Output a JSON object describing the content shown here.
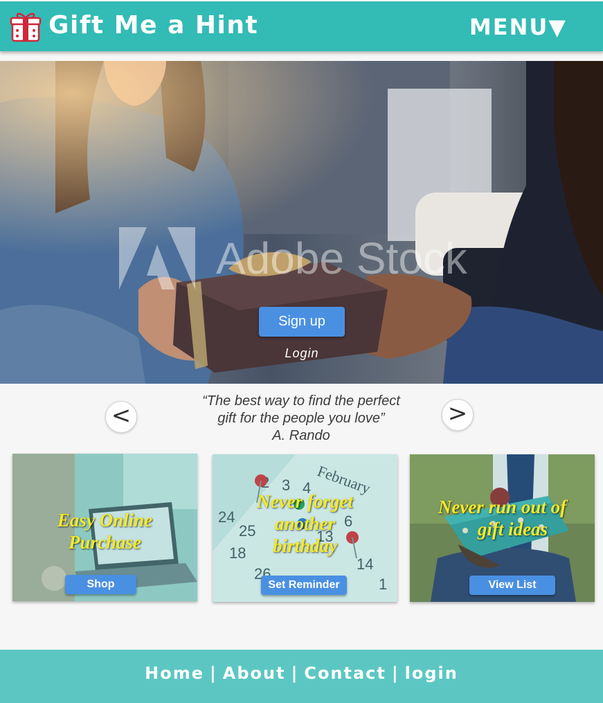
{
  "header": {
    "brand": "Gift Me a Hint",
    "menu_label": "MENU▼",
    "logo_icon": "gift-box-icon",
    "color": "#33bbb5"
  },
  "hero": {
    "image_icon": "gift-exchange-photo",
    "watermark": "Adobe Stock",
    "signup_label": "Sign up",
    "login_label": "Login"
  },
  "quote": {
    "prev_label": "<",
    "next_label": ">",
    "line1": "“The best way to find the perfect",
    "line2": "gift for the people you love”",
    "author": "A. Rando"
  },
  "cards": [
    {
      "title_line1": "Easy Online",
      "title_line2": "Purchase",
      "button": "Shop",
      "image_icon": "laptop-shopping-photo"
    },
    {
      "title_line1": "Never forget",
      "title_line2": "another",
      "title_line3": "birthday",
      "button": "Set Reminder",
      "image_icon": "calendar-photo",
      "calendar_month": "February"
    },
    {
      "title_line1": "Never run out of",
      "title_line2": "gift ideas",
      "button": "View List",
      "image_icon": "gift-box-photo"
    }
  ],
  "footer": {
    "links": [
      "Home",
      "About",
      "Contact",
      "login"
    ],
    "separator": "|",
    "color": "#5cc7c2"
  },
  "colors": {
    "accent_button": "#4a90e2",
    "card_title": "#f3ea2b"
  }
}
